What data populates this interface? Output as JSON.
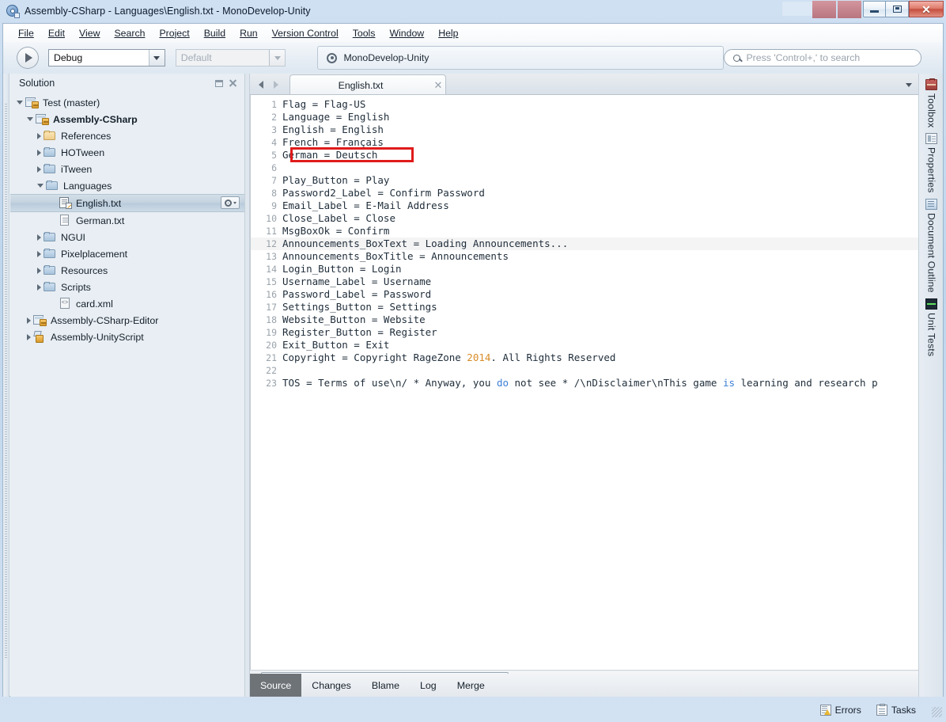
{
  "window": {
    "title": "Assembly-CSharp - Languages\\English.txt - MonoDevelop-Unity",
    "icon": "monodevelop-icon",
    "controls": {
      "minimize": "minimize-icon",
      "restore": "restore-icon",
      "close": "close-icon"
    }
  },
  "menubar": {
    "items": [
      {
        "label": "File"
      },
      {
        "label": "Edit"
      },
      {
        "label": "View"
      },
      {
        "label": "Search"
      },
      {
        "label": "Project"
      },
      {
        "label": "Build"
      },
      {
        "label": "Run"
      },
      {
        "label": "Version Control"
      },
      {
        "label": "Tools"
      },
      {
        "label": "Window"
      },
      {
        "label": "Help"
      }
    ]
  },
  "toolbar": {
    "run_button": "run-icon",
    "configuration": "Debug",
    "runtime_placeholder": "Default",
    "status_text": "MonoDevelop-Unity",
    "search_placeholder": "Press 'Control+,' to search"
  },
  "solution_pad": {
    "title": "Solution",
    "buttons": [
      "dock-icon",
      "close-icon"
    ],
    "tree": [
      {
        "label": "Test (master)",
        "indent": 0,
        "expander": "down",
        "icon": "solution-icon",
        "bold": false,
        "selected": false
      },
      {
        "label": "Assembly-CSharp",
        "indent": 1,
        "expander": "down",
        "icon": "project-icon",
        "bold": true,
        "selected": false
      },
      {
        "label": "References",
        "indent": 2,
        "expander": "right",
        "icon": "references-folder-icon",
        "bold": false,
        "selected": false
      },
      {
        "label": "HOTween",
        "indent": 2,
        "expander": "right",
        "icon": "folder-icon",
        "bold": false,
        "selected": false
      },
      {
        "label": "iTween",
        "indent": 2,
        "expander": "right",
        "icon": "folder-icon",
        "bold": false,
        "selected": false
      },
      {
        "label": "Languages",
        "indent": 2,
        "expander": "down",
        "icon": "folder-icon",
        "bold": false,
        "selected": false
      },
      {
        "label": "English.txt",
        "indent": 3,
        "expander": "none",
        "icon": "text-file-edit-icon",
        "bold": false,
        "selected": true
      },
      {
        "label": "German.txt",
        "indent": 3,
        "expander": "none",
        "icon": "text-file-icon",
        "bold": false,
        "selected": false
      },
      {
        "label": "NGUI",
        "indent": 2,
        "expander": "right",
        "icon": "folder-icon",
        "bold": false,
        "selected": false
      },
      {
        "label": "Pixelplacement",
        "indent": 2,
        "expander": "right",
        "icon": "folder-icon",
        "bold": false,
        "selected": false
      },
      {
        "label": "Resources",
        "indent": 2,
        "expander": "right",
        "icon": "folder-icon",
        "bold": false,
        "selected": false
      },
      {
        "label": "Scripts",
        "indent": 2,
        "expander": "right",
        "icon": "folder-icon",
        "bold": false,
        "selected": false
      },
      {
        "label": "card.xml",
        "indent": 3,
        "expander": "none",
        "icon": "xml-file-icon",
        "bold": false,
        "selected": false
      },
      {
        "label": "Assembly-CSharp-Editor",
        "indent": 1,
        "expander": "right",
        "icon": "project-icon",
        "bold": false,
        "selected": false
      },
      {
        "label": "Assembly-UnityScript",
        "indent": 1,
        "expander": "right",
        "icon": "unityscript-project-icon",
        "bold": false,
        "selected": false
      }
    ],
    "selected_row_menu": "gear-dropdown-icon"
  },
  "editor": {
    "nav_back": "nav-back-icon",
    "nav_forward": "nav-forward-icon",
    "tab": {
      "label": "English.txt",
      "close": "close-icon"
    },
    "tab_list_button": "chevron-down-icon",
    "highlighted_line": 12,
    "annotation": {
      "type": "red-rectangle",
      "target_line": 7,
      "text": "Play_Button = Play"
    },
    "lines": [
      {
        "n": "1",
        "text": "Flag = Flag-US"
      },
      {
        "n": "2",
        "text": "Language = English"
      },
      {
        "n": "3",
        "text": "English = English"
      },
      {
        "n": "4",
        "text": "French = Français"
      },
      {
        "n": "5",
        "text": "German = Deutsch"
      },
      {
        "n": "6",
        "text": ""
      },
      {
        "n": "7",
        "text": "Play_Button = Play"
      },
      {
        "n": "8",
        "text": "Password2_Label = Confirm Password"
      },
      {
        "n": "9",
        "text": "Email_Label = E-Mail Address"
      },
      {
        "n": "10",
        "text": "Close_Label = Close"
      },
      {
        "n": "11",
        "text": "MsgBoxOk = Confirm"
      },
      {
        "n": "12",
        "text": "Announcements_BoxText = Loading Announcements..."
      },
      {
        "n": "13",
        "text": "Announcements_BoxTitle = Announcements"
      },
      {
        "n": "14",
        "text": "Login_Button = Login"
      },
      {
        "n": "15",
        "text": "Username_Label = Username"
      },
      {
        "n": "16",
        "text": "Password_Label = Password"
      },
      {
        "n": "17",
        "text": "Settings_Button = Settings"
      },
      {
        "n": "18",
        "text": "Website_Button = Website"
      },
      {
        "n": "19",
        "text": "Register_Button = Register"
      },
      {
        "n": "20",
        "text": "Exit_Button = Exit"
      },
      {
        "n": "21",
        "text": "Copyright = Copyright RageZone 2014. All Rights Reserved",
        "parts": [
          {
            "t": "Copyright = Copyright RageZone ",
            "c": "plain"
          },
          {
            "t": "2014",
            "c": "number"
          },
          {
            "t": ". All Rights Reserved",
            "c": "plain"
          }
        ]
      },
      {
        "n": "22",
        "text": ""
      },
      {
        "n": "23",
        "text": "TOS = Terms of use\\n/ * Anyway, you do not see * /\\nDisclaimer\\nThis game is learning and research p",
        "parts": [
          {
            "t": "TOS = Terms of use\\n/ * Anyway, you ",
            "c": "plain"
          },
          {
            "t": "do",
            "c": "keyword"
          },
          {
            "t": " not see * /\\nDisclaimer\\nThis game ",
            "c": "plain"
          },
          {
            "t": "is",
            "c": "keyword"
          },
          {
            "t": " learning and research p",
            "c": "plain"
          }
        ]
      }
    ],
    "bottom_tabs": [
      {
        "label": "Source",
        "active": true
      },
      {
        "label": "Changes",
        "active": false
      },
      {
        "label": "Blame",
        "active": false
      },
      {
        "label": "Log",
        "active": false
      },
      {
        "label": "Merge",
        "active": false
      }
    ]
  },
  "right_dock": {
    "tabs": [
      {
        "label": "Toolbox",
        "icon": "toolbox-icon"
      },
      {
        "label": "Properties",
        "icon": "properties-icon"
      },
      {
        "label": "Document Outline",
        "icon": "document-outline-icon"
      },
      {
        "label": "Unit Tests",
        "icon": "unit-tests-icon"
      }
    ]
  },
  "statusbar": {
    "items": [
      {
        "label": "Errors",
        "icon": "errors-icon"
      },
      {
        "label": "Tasks",
        "icon": "tasks-icon"
      }
    ]
  },
  "colors": {
    "accent_red": "#e01b1b",
    "number_token": "#d98c28",
    "keyword_token": "#3b7fd4",
    "active_tab_bg": "#6e7378"
  }
}
